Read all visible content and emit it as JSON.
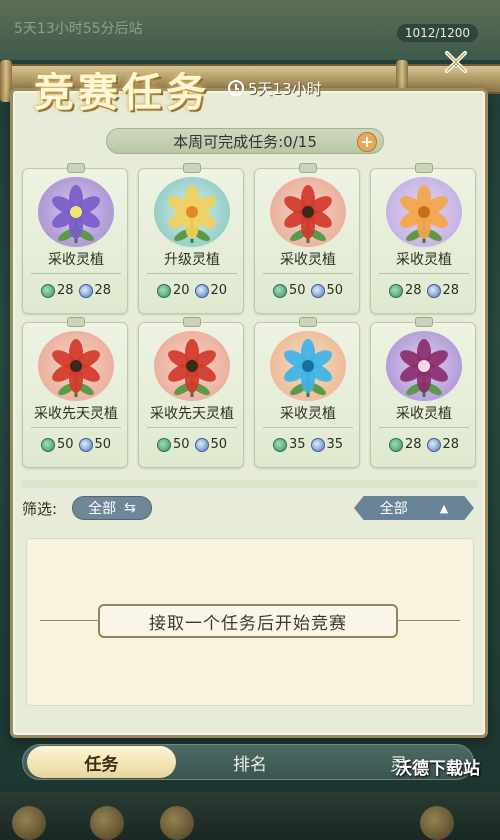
{
  "background": {
    "top_text": "5天13小时55分后站",
    "counter": "1012/1200"
  },
  "header": {
    "title": "竞赛任务",
    "timer": "5天13小时"
  },
  "quota": {
    "label": "本周可完成任务:0/15",
    "plus": "+"
  },
  "cards": [
    {
      "name": "采收灵植",
      "leaf": "28",
      "orb": "28",
      "art": "purple-lily"
    },
    {
      "name": "升级灵植",
      "leaf": "20",
      "orb": "20",
      "art": "yellow-flowers-teal"
    },
    {
      "name": "采收灵植",
      "leaf": "50",
      "orb": "50",
      "art": "red-lily-fairy"
    },
    {
      "name": "采收灵植",
      "leaf": "28",
      "orb": "28",
      "art": "orange-roses"
    },
    {
      "name": "采收先天灵植",
      "leaf": "50",
      "orb": "50",
      "art": "red-lily-fairy"
    },
    {
      "name": "采收先天灵植",
      "leaf": "50",
      "orb": "50",
      "art": "red-lily-fairy"
    },
    {
      "name": "采收灵植",
      "leaf": "35",
      "orb": "35",
      "art": "blue-rose"
    },
    {
      "name": "采收灵植",
      "leaf": "28",
      "orb": "28",
      "art": "purple-venus"
    }
  ],
  "filter": {
    "label": "筛选:",
    "left_value": "全部",
    "right_value": "全部"
  },
  "empty_state": {
    "message": "接取一个任务后开始竞赛"
  },
  "tabs": [
    {
      "label": "任务",
      "active": true
    },
    {
      "label": "排名",
      "active": false
    },
    {
      "label": "灵",
      "active": false
    }
  ],
  "watermark": "沃德下载站",
  "colors": {
    "panel": "#e7ecd9",
    "accent": "#e9a95a",
    "filter_pill": "#6f8797"
  }
}
